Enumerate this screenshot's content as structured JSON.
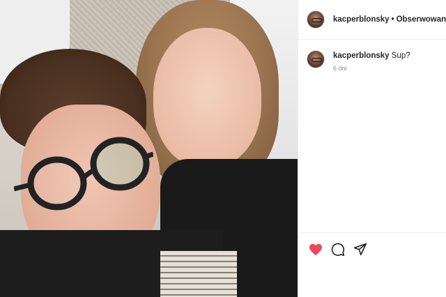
{
  "post": {
    "author": {
      "username": "kacperblonsky",
      "separator": "•",
      "follow_label": "Obserwowanie"
    },
    "caption": {
      "username": "kacperblonsky",
      "text": "Sup?",
      "time": "6 dni"
    },
    "actions": {
      "like_icon": "heart-filled-icon",
      "comment_icon": "comment-bubble-icon",
      "share_icon": "paper-plane-icon"
    },
    "colors": {
      "like_red": "#ed4956",
      "text": "#262626",
      "muted": "#8e8e8e",
      "border": "#efefef"
    }
  }
}
